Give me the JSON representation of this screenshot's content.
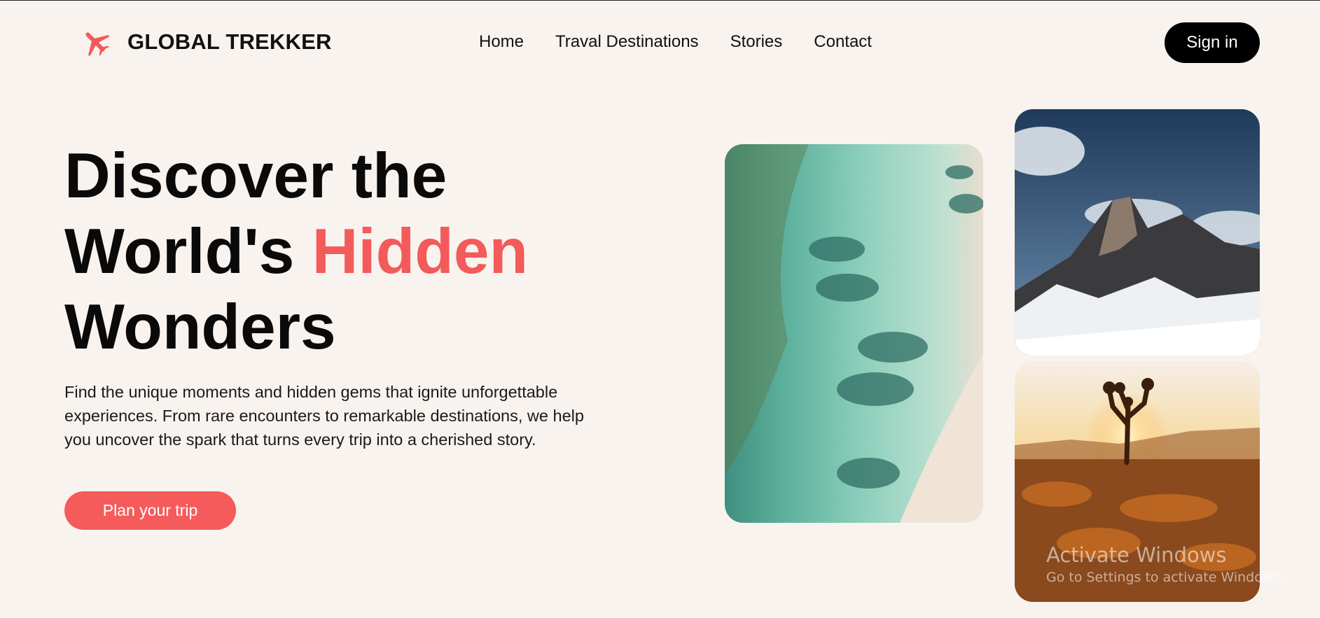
{
  "header": {
    "brand_name": "GLOBAL TREKKER",
    "brand_icon": "airplane-icon",
    "nav": [
      "Home",
      "Traval Destinations",
      "Stories",
      "Contact"
    ],
    "signin_label": "Sign in"
  },
  "hero": {
    "title_line1": "Discover the",
    "title_line2_prefix": "World's ",
    "title_line2_accent": "Hidden",
    "title_line3": "Wonders",
    "description": "Find the unique moments and hidden gems that ignite unforgettable experiences. From rare encounters to remarkable destinations, we help you uncover the spark that turns every trip into a cherished story.",
    "cta_label": "Plan your trip"
  },
  "gallery": [
    {
      "name": "beach-aerial-photo"
    },
    {
      "name": "snowy-mountain-photo"
    },
    {
      "name": "desert-joshua-tree-photo"
    }
  ],
  "watermark": {
    "title": "Activate Windows",
    "subtitle": "Go to Settings to activate Windows."
  },
  "colors": {
    "background": "#f8f3ef",
    "accent": "#f35a5a",
    "button_dark": "#000000"
  }
}
